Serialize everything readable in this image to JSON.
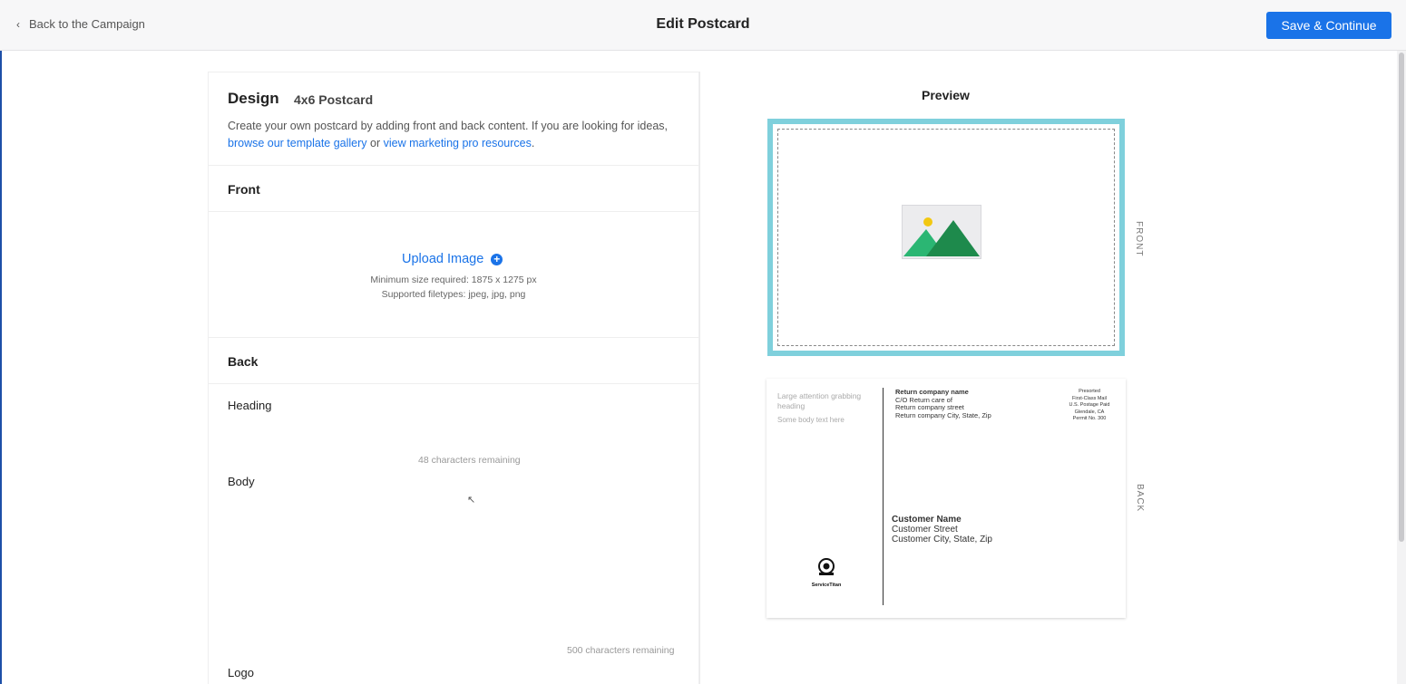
{
  "header": {
    "back_label": "Back to the Campaign",
    "title": "Edit Postcard",
    "save_label": "Save & Continue"
  },
  "design": {
    "title": "Design",
    "size_label": "4x6 Postcard",
    "intro_text": "Create your own postcard by adding front and back content. If you are looking for ideas,",
    "link_gallery": "browse our template gallery",
    "intro_or": " or ",
    "link_resources": "view marketing pro resources",
    "intro_end": ".",
    "front": {
      "label": "Front",
      "upload_label": "Upload Image",
      "min_size": "Minimum size required: 1875 x 1275 px",
      "filetypes": "Supported filetypes: jpeg, jpg, png"
    },
    "back": {
      "label": "Back",
      "heading_label": "Heading",
      "heading_value": "",
      "heading_counter": "48 characters remaining",
      "body_label": "Body",
      "body_value": "",
      "body_counter": "500 characters remaining",
      "logo_label": "Logo"
    }
  },
  "preview": {
    "title": "Preview",
    "front_label": "FRONT",
    "back_label": "BACK",
    "back_card": {
      "heading_placeholder": "Large attention grabbing heading",
      "body_placeholder": "Some body text here",
      "return_name": "Return company name",
      "return_lines": [
        "C/O Return care of",
        "Return company street",
        "Return company City, State, Zip"
      ],
      "postage_lines": [
        "Presorted",
        "First-Class Mail",
        "U.S. Postage Paid",
        "Glendale, CA",
        "Permit No. 300"
      ],
      "customer_name": "Customer Name",
      "customer_street": "Customer Street",
      "customer_city": "Customer City, State, Zip",
      "logo_text": "ServiceTitan"
    }
  },
  "colors": {
    "accent": "#1a73e8",
    "front_border": "#7fd0dc",
    "image_green_light": "#2bb673",
    "image_green_dark": "#1e8a4c",
    "image_sun": "#f2c811"
  }
}
